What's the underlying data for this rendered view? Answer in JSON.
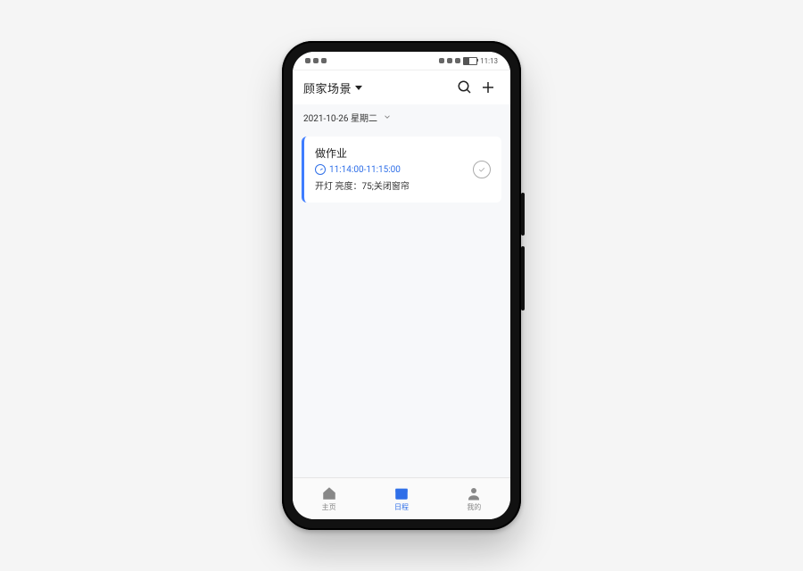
{
  "statusbar": {
    "time": "11:13"
  },
  "header": {
    "scene_label": "顾家场景"
  },
  "date_row": {
    "label": "2021-10-26 星期二"
  },
  "tasks": [
    {
      "title": "做作业",
      "time_range": "11:14:00-11:15:00",
      "description": "开灯 亮度：75;关闭窗帘"
    }
  ],
  "tabbar": {
    "home": "主页",
    "schedule": "日程",
    "mine": "我的"
  }
}
